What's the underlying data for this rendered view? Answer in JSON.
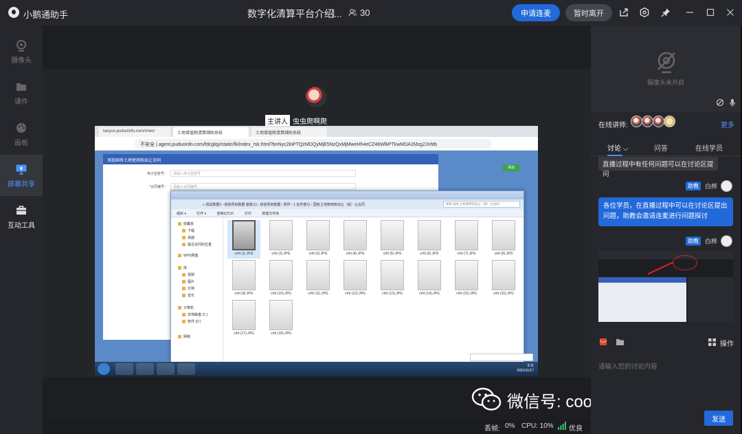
{
  "app": {
    "name": "小鹅通助手"
  },
  "header": {
    "room_title": "数字化清算平台介绍...",
    "separator": "|",
    "participants": "30",
    "apply_button": "申请连麦",
    "leave_button": "暂时离开"
  },
  "sidebar": {
    "items": [
      {
        "label": "摄像头"
      },
      {
        "label": "课件"
      },
      {
        "label": "画板"
      },
      {
        "label": "屏幕共享"
      },
      {
        "label": "互动工具"
      }
    ]
  },
  "stage": {
    "presenter_role": "主讲人",
    "presenter_name": "虫虫爬啊爬"
  },
  "shared_screen": {
    "tabs": [
      "taoyun.puduoinfo.com/#/wor",
      "土地增值税清算辅助系统",
      "土地增值税清算辅助系统"
    ],
    "address": "不安全 | agent.puduoinfo.com/fdcglqy/static/fk/index_rsk.html?bnNyc2loPTQzMDQyMjE5NzQxMjMweHh4eCZ4bWlkPTkwMDA2Mzg2Jnhtb",
    "dialog_title": "添加国有土地使用权出让合同",
    "form": [
      {
        "label": "电子监管号：",
        "placeholder": "请输入电子监管号"
      },
      {
        "label": "*合同编号：",
        "placeholder": "请输入合同编号"
      }
    ],
    "add_button": "添加",
    "explorer_path": "« 测试数据2 › 体验项目数据 最新(1) › 体验项目数据 › 附件 › 1.证件部分 › 国有土地使用权出让（受）让合同",
    "explorer_search": "搜索 国有土地使用权出让（受）让合同",
    "explorer_toolbar": [
      "组织 ▾",
      "打开 ▾",
      "放映幻灯片",
      "打印",
      "新建文件夹"
    ],
    "explorer_nav": [
      "收藏夹",
      "下载",
      "桌面",
      "最近访问的位置",
      "WPS网盘",
      "库",
      "视频",
      "图片",
      "文档",
      "音乐",
      "计算机",
      "本地磁盘 (C:)",
      "软件 (D:)",
      "网络"
    ],
    "files": [
      "crht (1).JPG",
      "crht (2).JPG",
      "crht (3).JPG",
      "crht (4).JPG",
      "crht (5).JPG",
      "crht (6).JPG",
      "crht (7).JPG",
      "crht (8).JPG",
      "crht (9).JPG",
      "crht (10).JPG",
      "crht (11).JPG",
      "crht (12).JPG",
      "crht (13).JPG",
      "crht (14).JPG",
      "crht (15).JPG",
      "crht (16).JPG",
      "crht (17).JPG",
      "crht (18).JPG"
    ],
    "taskbar_time": "9:11",
    "taskbar_date": "2021/11/17"
  },
  "watermark": {
    "text": "微信号: cooperation-soft"
  },
  "status": {
    "frame_loss_label": "丢帧:",
    "frame_loss_value": "0%",
    "cpu": "CPU: 10%",
    "network": "优良"
  },
  "right_panel": {
    "camera_off": "摄像头未开启",
    "lecturers_label": "在线讲师:",
    "more": "更多",
    "tabs": [
      "讨论",
      "问答",
      "在线学员"
    ],
    "messages": [
      {
        "text": "直播过程中有任何问题可以在讨论区提问"
      },
      {
        "role": "助教",
        "sender": "白桦",
        "text": "各位学员，在直播过程中可以在讨论区提出问题，助教会邀请连麦进行问题探讨"
      },
      {
        "role": "助教",
        "sender": "白桦"
      }
    ],
    "operate_label": "操作",
    "input_placeholder": "请输入您的讨论内容",
    "send_button": "发送"
  },
  "colors": {
    "accent": "#2269d9",
    "bg": "#1b1c20",
    "panel": "#26272c"
  }
}
